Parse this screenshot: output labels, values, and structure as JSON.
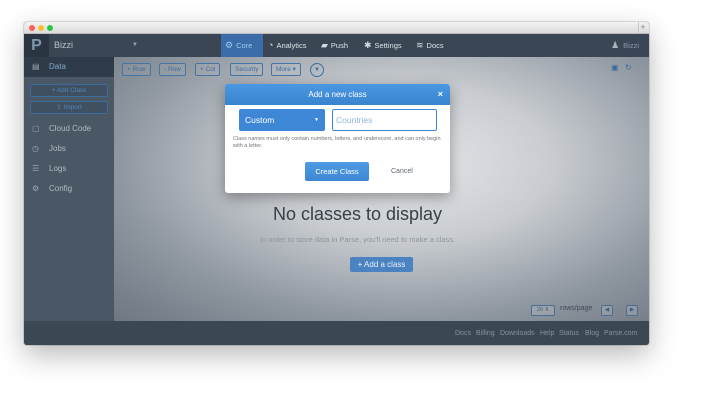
{
  "app": {
    "logo": "P",
    "name": "Bizzi",
    "user": "Bizzi"
  },
  "nav": {
    "tabs": [
      {
        "label": "Core",
        "icon": "gear-icon",
        "glyph": "⚙"
      },
      {
        "label": "Analytics",
        "icon": "analytics-icon",
        "glyph": "◔"
      },
      {
        "label": "Push",
        "icon": "push-icon",
        "glyph": "▰"
      },
      {
        "label": "Settings",
        "icon": "settings-icon",
        "glyph": "✱"
      },
      {
        "label": "Docs",
        "icon": "docs-icon",
        "glyph": "≋"
      }
    ]
  },
  "sidebar": {
    "data_label": "Data",
    "add_class": "+ Add Class",
    "import": "Import",
    "items": [
      {
        "label": "Cloud Code"
      },
      {
        "label": "Jobs"
      },
      {
        "label": "Logs"
      },
      {
        "label": "Config"
      }
    ]
  },
  "toolbar": {
    "add_row": "+ Row",
    "remove_row": "- Row",
    "add_col": "+ Col",
    "security": "Security",
    "more": "More ▾"
  },
  "empty": {
    "title": "No classes to display",
    "subtitle": "In order to store data in Parse, you'll need to make a class.",
    "add_button": "+ Add a class"
  },
  "pager": {
    "rows": "20",
    "rows_label": "rows/page"
  },
  "footer": {
    "links": [
      "Docs",
      "Billing",
      "Downloads",
      "Help",
      "Status",
      "Blog",
      "Parse.com"
    ]
  },
  "modal": {
    "title": "Add a new class",
    "close": "×",
    "type_selected": "Custom",
    "name_placeholder": "Countries",
    "hint": "Class names must only contain numbers, letters, and underscore, and can only begin with a letter.",
    "create": "Create Class",
    "cancel": "Cancel"
  },
  "colors": {
    "accent": "#3d87d6",
    "active_tab": "#3b6ea9",
    "nav_bg": "#3a4654",
    "sidebar_bg": "#4a5866"
  }
}
